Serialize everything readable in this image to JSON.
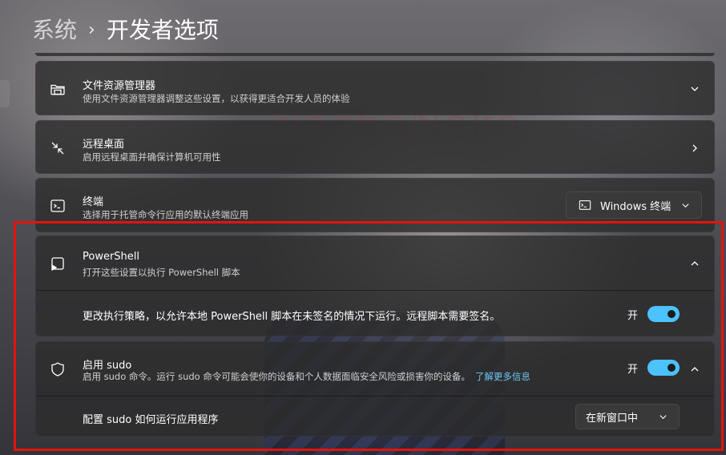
{
  "breadcrumb": {
    "parent": "系统",
    "separator": "›",
    "current": "开发者选项"
  },
  "file_explorer": {
    "title": "文件资源管理器",
    "description": "使用文件资源管理器调整这些设置，以获得更适合开发人员的体验",
    "icon": "folder-icon"
  },
  "remote_desktop": {
    "title": "远程桌面",
    "description": "启用远程桌面并确保计算机可用性",
    "icon": "remote-desktop-icon"
  },
  "terminal": {
    "title": "终端",
    "description": "选择用于托管命令行应用的默认终端应用",
    "icon": "terminal-icon",
    "dropdown_value": "Windows 终端"
  },
  "powershell": {
    "title": "PowerShell",
    "description": "打开这些设置以执行 PowerShell 脚本",
    "icon": "powershell-icon",
    "setting_label": "更改执行策略，以允许本地 PowerShell 脚本在未签名的情况下运行。远程脚本需要签名。",
    "toggle_label": "开",
    "toggle_on": true
  },
  "sudo": {
    "title": "启用 sudo",
    "description": "启用 sudo 命令。运行 sudo 命令可能会使你的设备和个人数据面临安全风险或损害你的设备。",
    "link": "了解更多信息",
    "icon": "shield-icon",
    "toggle_label": "开",
    "toggle_on": true,
    "config_label": "配置 sudo 如何运行应用程序",
    "config_value": "在新窗口中"
  },
  "colors": {
    "accent": "#4cc2ff",
    "link": "#6cc7f2",
    "highlight": "#e3130d"
  }
}
